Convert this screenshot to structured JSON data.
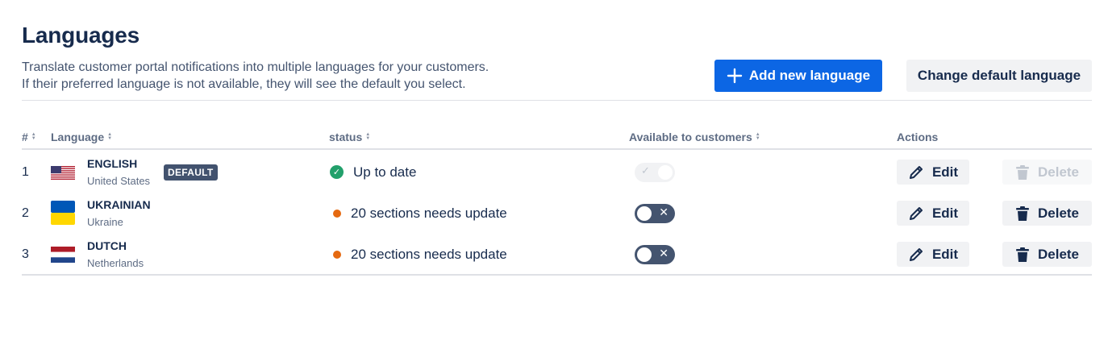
{
  "header": {
    "title": "Languages",
    "description_line1": "Translate customer portal notifications into multiple languages for your customers.",
    "description_line2": "If their preferred language is not available, they will see the default you select.",
    "add_button_label": "Add new language",
    "change_default_label": "Change default language"
  },
  "table": {
    "columns": {
      "num": "#",
      "language": "Language",
      "status": "status",
      "available": "Available to customers",
      "actions": "Actions"
    },
    "rows": [
      {
        "num": "1",
        "name": "ENGLISH",
        "region": "United States",
        "badge": "DEFAULT",
        "flag": "us-flag-icon",
        "status": "Up to date",
        "status_icon": "check-circle-icon",
        "available": true,
        "toggle_disabled": true,
        "edit_label": "Edit",
        "delete_label": "Delete",
        "delete_disabled": true
      },
      {
        "num": "2",
        "name": "UKRAINIAN",
        "region": "Ukraine",
        "flag": "ukraine-flag-icon",
        "status": "20 sections needs update",
        "status_icon": "orange-dot-icon",
        "available": false,
        "toggle_disabled": false,
        "edit_label": "Edit",
        "delete_label": "Delete",
        "delete_disabled": false
      },
      {
        "num": "3",
        "name": "DUTCH",
        "region": "Netherlands",
        "flag": "netherlands-flag-icon",
        "status": "20 sections needs update",
        "status_icon": "orange-dot-icon",
        "available": false,
        "toggle_disabled": false,
        "edit_label": "Edit",
        "delete_label": "Delete",
        "delete_disabled": false
      }
    ]
  },
  "colors": {
    "primary": "#0c66e4",
    "success": "#22a06b",
    "warning": "#e56910",
    "badge": "#42526e",
    "toggle_off": "#44546f"
  }
}
